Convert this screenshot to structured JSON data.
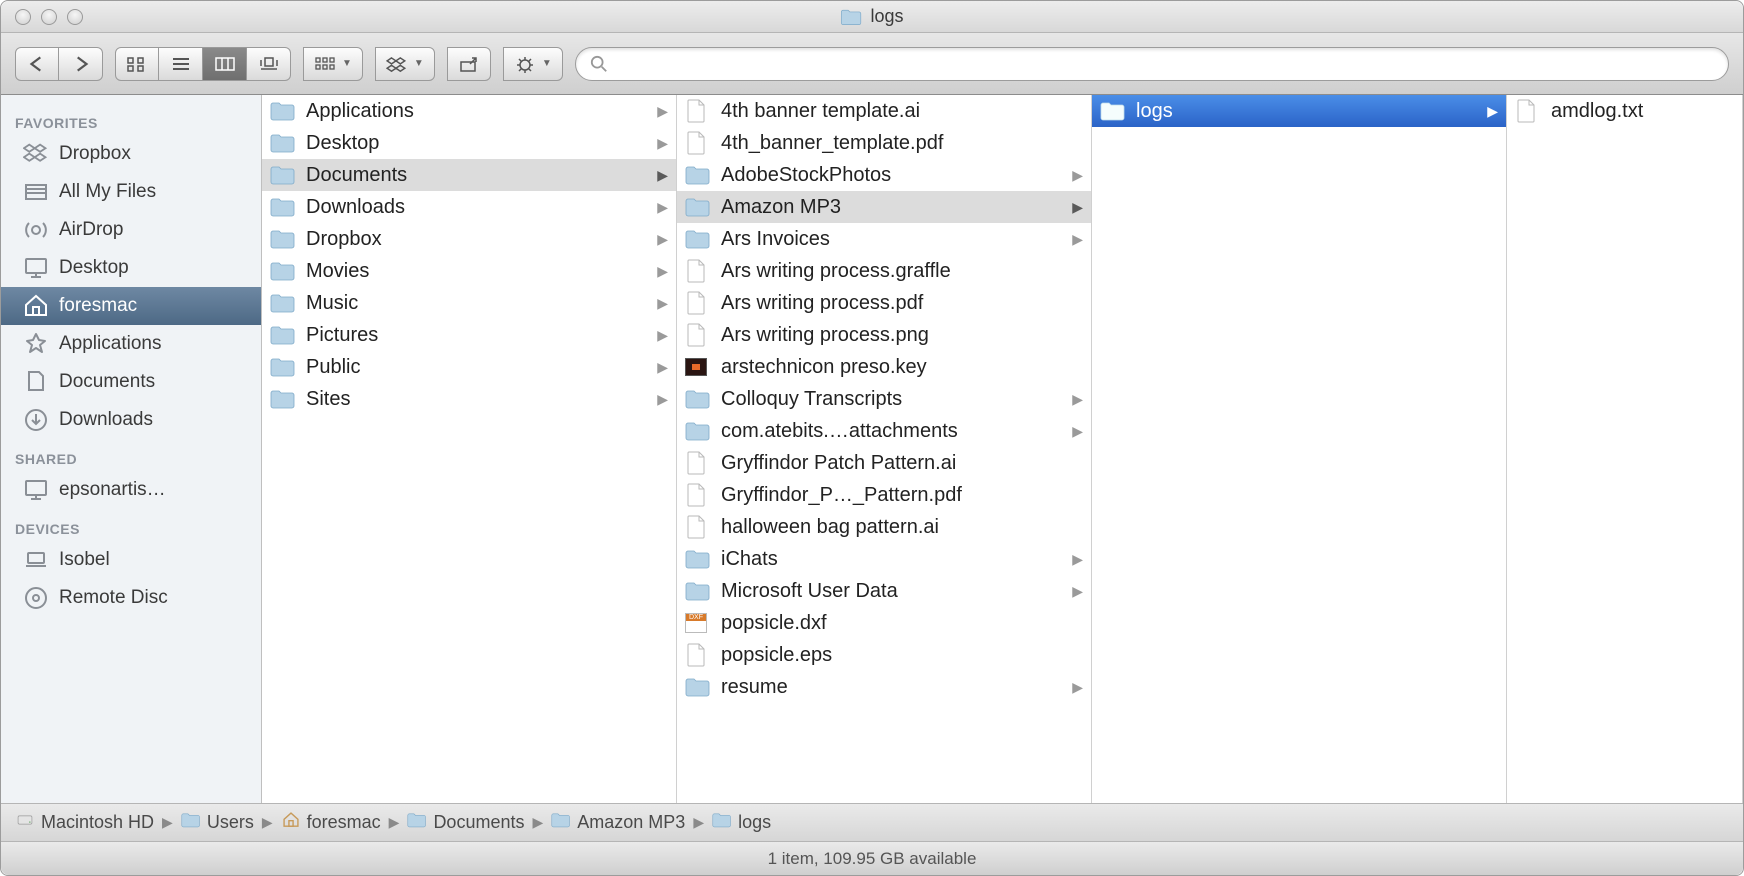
{
  "window": {
    "title": "logs"
  },
  "sidebar": {
    "sections": [
      {
        "header": "FAVORITES",
        "items": [
          {
            "label": "Dropbox",
            "icon": "dropbox"
          },
          {
            "label": "All My Files",
            "icon": "allfiles"
          },
          {
            "label": "AirDrop",
            "icon": "airdrop"
          },
          {
            "label": "Desktop",
            "icon": "desktop"
          },
          {
            "label": "foresmac",
            "icon": "home",
            "selected": true
          },
          {
            "label": "Applications",
            "icon": "apps"
          },
          {
            "label": "Documents",
            "icon": "doc"
          },
          {
            "label": "Downloads",
            "icon": "download"
          }
        ]
      },
      {
        "header": "SHARED",
        "items": [
          {
            "label": "epsonartis…",
            "icon": "computer"
          }
        ]
      },
      {
        "header": "DEVICES",
        "items": [
          {
            "label": "Isobel",
            "icon": "laptop"
          },
          {
            "label": "Remote Disc",
            "icon": "disc"
          }
        ]
      }
    ]
  },
  "columns": [
    [
      {
        "label": "Applications",
        "type": "folder-app",
        "arrow": true
      },
      {
        "label": "Desktop",
        "type": "folder",
        "arrow": true
      },
      {
        "label": "Documents",
        "type": "folder",
        "arrow": true,
        "pathSelected": true
      },
      {
        "label": "Downloads",
        "type": "folder-dl",
        "arrow": true
      },
      {
        "label": "Dropbox",
        "type": "folder-db",
        "arrow": true
      },
      {
        "label": "Movies",
        "type": "folder",
        "arrow": true
      },
      {
        "label": "Music",
        "type": "folder-music",
        "arrow": true
      },
      {
        "label": "Pictures",
        "type": "folder-pic",
        "arrow": true
      },
      {
        "label": "Public",
        "type": "folder",
        "arrow": true
      },
      {
        "label": "Sites",
        "type": "folder",
        "arrow": true
      }
    ],
    [
      {
        "label": "4th banner template.ai",
        "type": "file"
      },
      {
        "label": "4th_banner_template.pdf",
        "type": "pdf"
      },
      {
        "label": "AdobeStockPhotos",
        "type": "folder",
        "arrow": true
      },
      {
        "label": "Amazon MP3",
        "type": "folder",
        "arrow": true,
        "pathSelected": true
      },
      {
        "label": "Ars Invoices",
        "type": "folder",
        "arrow": true
      },
      {
        "label": "Ars writing process.graffle",
        "type": "graffle"
      },
      {
        "label": "Ars writing process.pdf",
        "type": "pdf"
      },
      {
        "label": "Ars writing process.png",
        "type": "image"
      },
      {
        "label": "arstechnicon preso.key",
        "type": "key"
      },
      {
        "label": "Colloquy Transcripts",
        "type": "folder",
        "arrow": true
      },
      {
        "label": "com.atebits.…attachments",
        "type": "folder",
        "arrow": true
      },
      {
        "label": "Gryffindor Patch Pattern.ai",
        "type": "file"
      },
      {
        "label": "Gryffindor_P…_Pattern.pdf",
        "type": "pdf"
      },
      {
        "label": "halloween bag pattern.ai",
        "type": "file"
      },
      {
        "label": "iChats",
        "type": "folder",
        "arrow": true
      },
      {
        "label": "Microsoft User Data",
        "type": "folder",
        "arrow": true
      },
      {
        "label": "popsicle.dxf",
        "type": "dxf"
      },
      {
        "label": "popsicle.eps",
        "type": "file"
      },
      {
        "label": "resume",
        "type": "folder",
        "arrow": true
      }
    ],
    [
      {
        "label": "logs",
        "type": "folder",
        "arrow": true,
        "activeSelected": true
      }
    ],
    [
      {
        "label": "amdlog.txt",
        "type": "file"
      }
    ]
  ],
  "pathbar": [
    {
      "label": "Macintosh HD",
      "icon": "hd"
    },
    {
      "label": "Users",
      "icon": "folder"
    },
    {
      "label": "foresmac",
      "icon": "home"
    },
    {
      "label": "Documents",
      "icon": "folder"
    },
    {
      "label": "Amazon MP3",
      "icon": "folder"
    },
    {
      "label": "logs",
      "icon": "folder"
    }
  ],
  "statusbar": "1 item, 109.95 GB available"
}
